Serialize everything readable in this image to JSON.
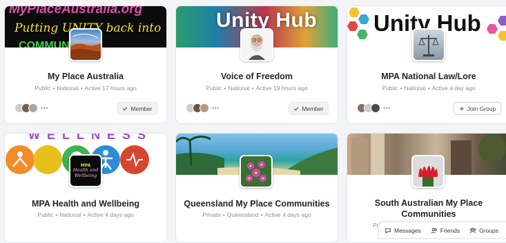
{
  "groups": [
    {
      "title": "My Place Australia",
      "title_line2": "",
      "privacy": "Public",
      "scope": "National",
      "activity": "Active 17 hours ago",
      "banner_lines": [
        "MyPlaceAustralia.org",
        "Putting UNITY back into",
        "COMMUNITY"
      ],
      "button": "Member",
      "show_members": true
    },
    {
      "title": "Voice of Freedom",
      "title_line2": "",
      "privacy": "Public",
      "scope": "National",
      "activity": "Active 19 hours ago",
      "banner_lines": [
        "Unity Hub"
      ],
      "button": "Member",
      "show_members": true
    },
    {
      "title": "MPA National Law/Lore",
      "title_line2": "",
      "privacy": "Public",
      "scope": "National",
      "activity": "Active a day ago",
      "banner_lines": [
        "Unity Hub"
      ],
      "button": "Join Group",
      "show_members": true
    },
    {
      "title": "MPA Health and Wellbeing",
      "title_line2": "",
      "privacy": "Public",
      "scope": "National",
      "activity": "Active 4 days ago",
      "banner_lines": [
        "WELLNESS"
      ],
      "avatar_lines": [
        "MPA",
        "Health and",
        "Wellbeing"
      ],
      "button": "",
      "show_members": false
    },
    {
      "title": "Queensland My Place Communities",
      "title_line2": "",
      "privacy": "Private",
      "scope": "Queensland",
      "activity": "Active 4 days ago",
      "banner_lines": [],
      "button": "",
      "show_members": false
    },
    {
      "title": "South Australian My Place",
      "title_line2": "Communities",
      "privacy": "Pri",
      "scope": "",
      "activity": "",
      "banner_lines": [],
      "button": "",
      "show_members": false
    }
  ],
  "more_glyph": "•••",
  "bottom_bar": {
    "messages": "Messages",
    "friends": "Friends",
    "groups": "Groups"
  },
  "colors": {
    "card_border": "#e3e5e8",
    "title": "#1f2328",
    "meta": "#8a8f98",
    "member_btn_bg": "#f1f2f4"
  }
}
